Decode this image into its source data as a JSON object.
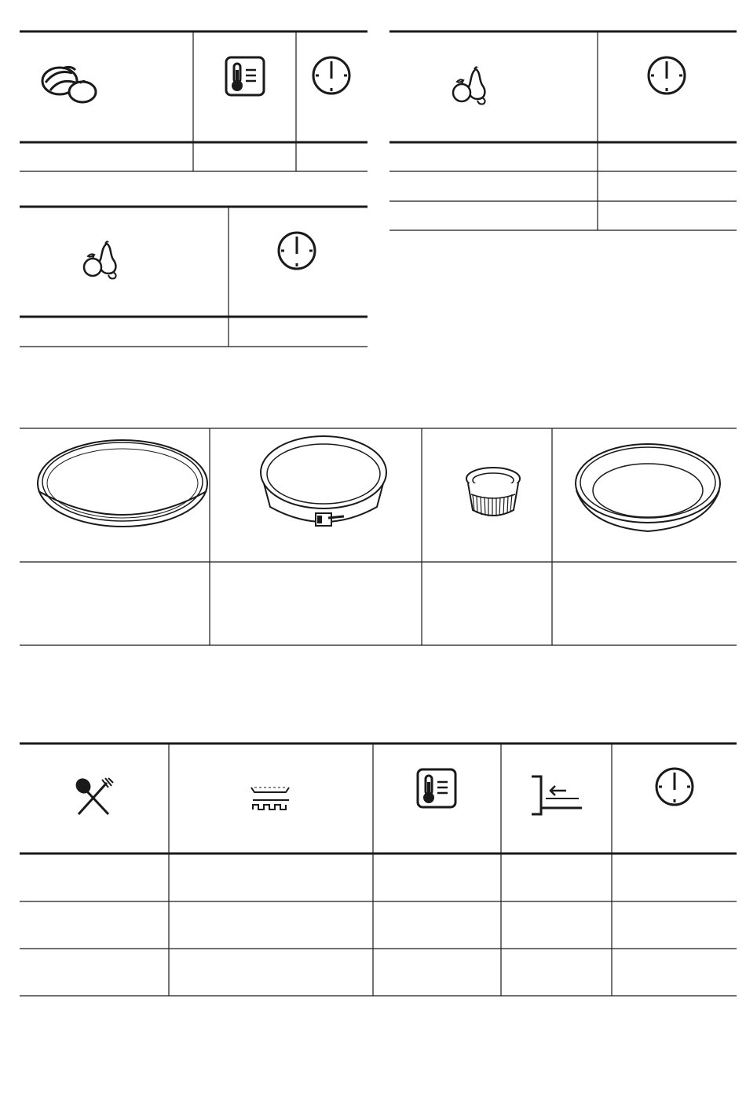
{
  "document": {
    "sections": [
      {
        "id": "table-vegetables",
        "header_icons": [
          "vegetables-icon",
          "temperature-icon",
          "clock-icon"
        ],
        "rows": [
          [
            "",
            "",
            ""
          ]
        ]
      },
      {
        "id": "table-fruit-right",
        "header_icons": [
          "fruit-icon",
          "clock-icon"
        ],
        "rows": [
          [
            "",
            ""
          ],
          [
            "",
            ""
          ],
          [
            "",
            ""
          ]
        ]
      },
      {
        "id": "table-fruit-left",
        "header_icons": [
          "fruit-icon",
          "clock-icon"
        ],
        "rows": [
          [
            "",
            ""
          ]
        ]
      },
      {
        "id": "table-bakeware",
        "header_images": [
          "flan-dish-image",
          "springform-pan-image",
          "ramekin-image",
          "deep-pie-dish-image"
        ],
        "rows": [
          [
            "",
            "",
            "",
            ""
          ]
        ]
      },
      {
        "id": "table-cooking",
        "header_icons": [
          "cutlery-icon",
          "grill-tray-icon",
          "temperature-icon",
          "shelf-position-icon",
          "clock-icon"
        ],
        "rows": [
          [
            "",
            "",
            "",
            "",
            ""
          ],
          [
            "",
            "",
            "",
            "",
            ""
          ],
          [
            "",
            "",
            "",
            "",
            ""
          ]
        ]
      }
    ]
  }
}
